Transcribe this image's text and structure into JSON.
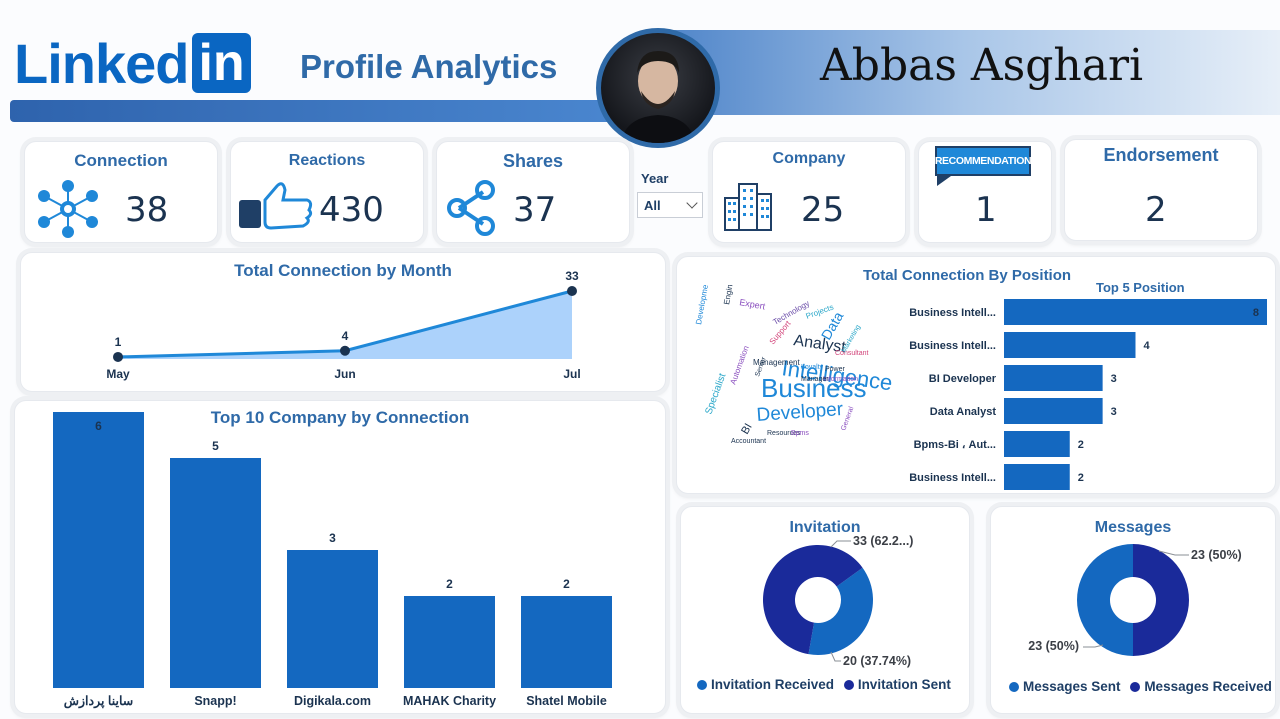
{
  "header": {
    "logo_text": "Linked",
    "logo_box": "in",
    "subtitle": "Profile Analytics",
    "profile_name": "Abbas Asghari"
  },
  "kpis": {
    "connection": {
      "label": "Connection",
      "value": "38"
    },
    "reactions": {
      "label": "Reactions",
      "value": "430"
    },
    "shares": {
      "label": "Shares",
      "value": "37"
    },
    "company": {
      "label": "Company",
      "value": "25"
    },
    "recommendation": {
      "label": "RECOMMENDATION",
      "value": "1"
    },
    "endorsement": {
      "label": "Endorsement",
      "value": "2"
    }
  },
  "filter": {
    "label": "Year",
    "value": "All"
  },
  "colors": {
    "brand": "#0a66c2",
    "bar": "#1468c0",
    "area": "#a8d0fb",
    "navy": "#1a2a9a",
    "header_band": "#3f77c0"
  },
  "chart_data": [
    {
      "type": "area",
      "title": "Total Connection by Month",
      "categories": [
        "May",
        "Jun",
        "Jul"
      ],
      "values": [
        1,
        4,
        33
      ],
      "data_labels": [
        "1",
        "4",
        "33"
      ],
      "ylim": [
        0,
        33
      ]
    },
    {
      "type": "bar",
      "title": "Top 10 Company by Connection",
      "categories": [
        "ساینا پردازش",
        "Snapp!",
        "Digikala.com",
        "MAHAK Charity",
        "Shatel Mobile"
      ],
      "values": [
        6,
        5,
        3,
        2,
        2
      ],
      "ylim": [
        0,
        6
      ]
    },
    {
      "type": "bar",
      "orientation": "horizontal",
      "title": "Top 5 Position",
      "categories": [
        "Business Intell...",
        "Business Intell...",
        "BI Developer",
        "Data Analyst",
        "Bpms-Bi ، Aut...",
        "Business Intell..."
      ],
      "values": [
        8,
        4,
        3,
        3,
        2,
        2
      ],
      "xlim": [
        0,
        8
      ]
    },
    {
      "type": "pie",
      "title": "Invitation",
      "series": [
        {
          "name": "Invitation Received",
          "value": 20,
          "label": "20 (37.74%)",
          "color": "#1468c0"
        },
        {
          "name": "Invitation Sent",
          "value": 33,
          "label": "33 (62.2...)",
          "color": "#1a2a9a"
        }
      ]
    },
    {
      "type": "pie",
      "title": "Messages",
      "series": [
        {
          "name": "Messages Sent",
          "value": 23,
          "label": "23 (50%)",
          "color": "#1468c0"
        },
        {
          "name": "Messages Received",
          "value": 23,
          "label": "23 (50%)",
          "color": "#1a2a9a"
        }
      ]
    }
  ],
  "wordcloud": {
    "title": "Total Connection By Position",
    "words": [
      "Business",
      "Intelligence",
      "Developer",
      "Analyst",
      "Data",
      "BI",
      "Specialist",
      "Expert",
      "Development",
      "Automation",
      "Management",
      "Technology",
      "Projects",
      "Support",
      "Engineer",
      "Resources",
      "Information",
      "Power",
      "Loyalty",
      "Manager",
      "Consultant",
      "Marketing",
      "General",
      "Senior",
      "Accountant",
      "Bpms"
    ]
  }
}
